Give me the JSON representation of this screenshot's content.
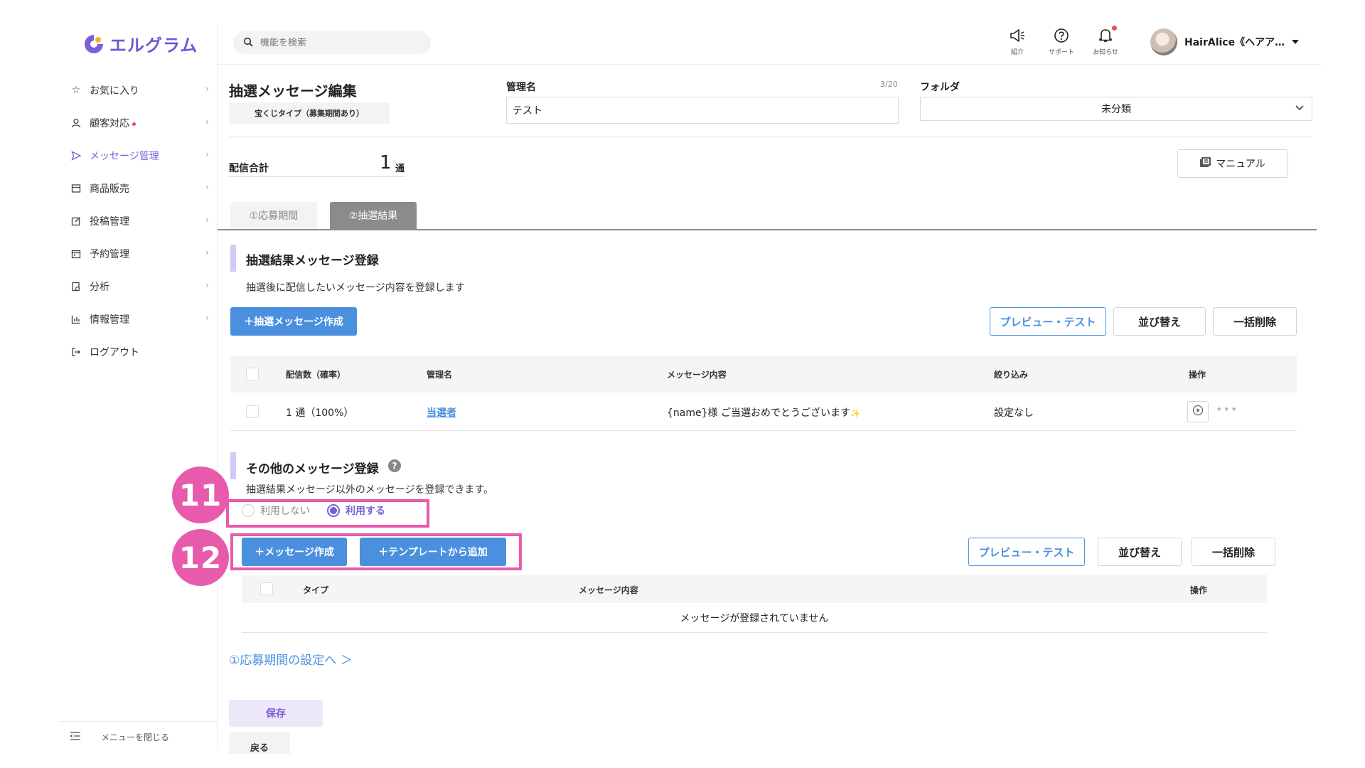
{
  "app": {
    "logo_text": "エルグラム",
    "brand_color": "#6f57d6"
  },
  "sidebar": {
    "items": [
      {
        "label": "お気に入り",
        "icon": "star-icon"
      },
      {
        "label": "顧客対応",
        "icon": "user-icon",
        "dot": true
      },
      {
        "label": "メッセージ管理",
        "icon": "send-icon",
        "active": true
      },
      {
        "label": "商品販売",
        "icon": "shop-icon"
      },
      {
        "label": "投稿管理",
        "icon": "edit-icon"
      },
      {
        "label": "予約管理",
        "icon": "calendar-icon"
      },
      {
        "label": "分析",
        "icon": "report-icon"
      },
      {
        "label": "情報管理",
        "icon": "chart-icon"
      },
      {
        "label": "ログアウト",
        "icon": "logout-icon"
      }
    ],
    "close_label": "メニューを閉じる"
  },
  "search": {
    "placeholder": "機能を検索"
  },
  "topbar": {
    "intro": "紹介",
    "support": "サポート",
    "notice": "お知らせ",
    "user_name": "HairAlice《ヘアア…"
  },
  "page": {
    "title": "抽選メッセージ編集",
    "type_badge": "宝くじタイプ（募集期間あり）",
    "name_label": "管理名",
    "name_count": "3/20",
    "name_value": "テスト",
    "folder_label": "フォルダ",
    "folder_value": "未分類",
    "total_label": "配信合計",
    "total_value": "1",
    "total_unit": "通",
    "manual_label": "マニュアル"
  },
  "tabs": [
    {
      "label": "①応募期間"
    },
    {
      "label": "②抽選結果"
    }
  ],
  "result_section": {
    "title": "抽選結果メッセージ登録",
    "desc": "抽選後に配信したいメッセージ内容を登録します",
    "create_btn": "＋抽選メッセージ作成",
    "preview_btn": "プレビュー・テスト",
    "sort_btn": "並び替え",
    "delete_btn": "一括削除",
    "columns": [
      "配信数（確率）",
      "管理名",
      "メッセージ内容",
      "絞り込み",
      "操作"
    ],
    "rows": [
      {
        "count": "1 通（100%）",
        "name": "当選者",
        "content": "{name}様 ご当選おめでとうございます",
        "sparkle": "✨",
        "filter": "設定なし"
      }
    ]
  },
  "other_section": {
    "title": "その他のメッセージ登録",
    "help": "?",
    "desc": "抽選結果メッセージ以外のメッセージを登録できます。",
    "radio_off": "利用しない",
    "radio_on": "利用する",
    "create_btn": "＋メッセージ作成",
    "template_btn": "＋テンプレートから追加",
    "preview_btn": "プレビュー・テスト",
    "sort_btn": "並び替え",
    "delete_btn": "一括削除",
    "columns": [
      "タイプ",
      "メッセージ内容",
      "操作"
    ],
    "empty": "メッセージが登録されていません"
  },
  "footer": {
    "back_link": "①応募期間の設定へ ＞",
    "save": "保存",
    "return": "戻る"
  },
  "annotations": {
    "step11": "11",
    "step12": "12",
    "color": "#e85aac"
  }
}
